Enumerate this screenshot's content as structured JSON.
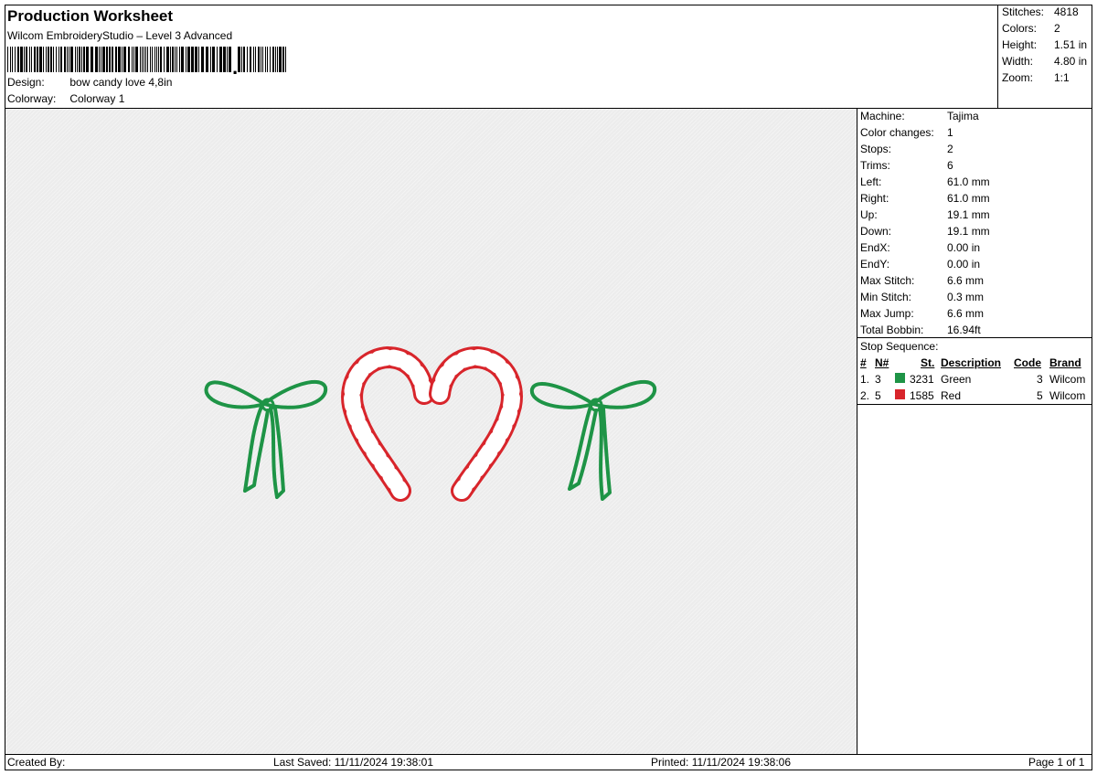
{
  "header": {
    "title": "Production Worksheet",
    "subtitle": "Wilcom EmbroideryStudio – Level 3 Advanced",
    "design_label": "Design:",
    "design_value": "bow candy love 4,8in",
    "colorway_label": "Colorway:",
    "colorway_value": "Colorway 1"
  },
  "summary": [
    {
      "label": "Stitches:",
      "value": "4818"
    },
    {
      "label": "Colors:",
      "value": "2"
    },
    {
      "label": "Height:",
      "value": "1.51 in"
    },
    {
      "label": "Width:",
      "value": "4.80 in"
    },
    {
      "label": "Zoom:",
      "value": "1:1"
    }
  ],
  "machine_info": [
    {
      "label": "Machine:",
      "value": "Tajima"
    },
    {
      "label": "Color changes:",
      "value": "1"
    },
    {
      "label": "Stops:",
      "value": "2"
    },
    {
      "label": "Trims:",
      "value": "6"
    },
    {
      "label": "Left:",
      "value": "61.0 mm"
    },
    {
      "label": "Right:",
      "value": "61.0 mm"
    },
    {
      "label": "Up:",
      "value": "19.1 mm"
    },
    {
      "label": "Down:",
      "value": "19.1 mm"
    },
    {
      "label": "EndX:",
      "value": "0.00 in"
    },
    {
      "label": "EndY:",
      "value": "0.00 in"
    },
    {
      "label": "Max Stitch:",
      "value": "6.6 mm"
    },
    {
      "label": "Min Stitch:",
      "value": "0.3 mm"
    },
    {
      "label": "Max Jump:",
      "value": "6.6 mm"
    },
    {
      "label": "Total Bobbin:",
      "value": "16.94ft"
    }
  ],
  "stop_sequence": {
    "title": "Stop Sequence:",
    "headers": {
      "num": "#",
      "n": "N#",
      "st": "St.",
      "description": "Description",
      "code": "Code",
      "brand": "Brand"
    },
    "rows": [
      {
        "num": "1.",
        "n": "3",
        "color": "#1e9446",
        "st": "3231",
        "description": "Green",
        "code": "3",
        "brand": "Wilcom"
      },
      {
        "num": "2.",
        "n": "5",
        "color": "#d8252b",
        "st": "1585",
        "description": "Red",
        "code": "5",
        "brand": "Wilcom"
      }
    ]
  },
  "footer": {
    "created_by": "Created By:",
    "last_saved": "Last Saved: 11/11/2024 19:38:01",
    "printed": "Printed: 11/11/2024 19:38:06",
    "page": "Page 1 of 1"
  },
  "colors": {
    "green": "#1e9446",
    "red": "#d8252b",
    "canvas_bg": "#ececec"
  }
}
